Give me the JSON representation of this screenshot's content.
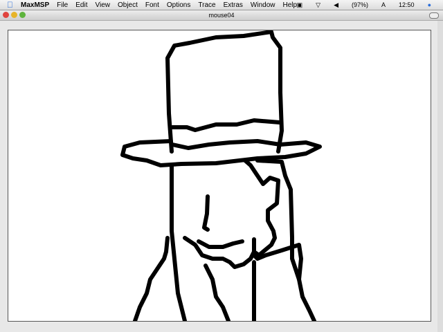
{
  "menubar": {
    "app": "MaxMSP",
    "items": [
      "File",
      "Edit",
      "View",
      "Object",
      "Font",
      "Options",
      "Trace",
      "Extras",
      "Window",
      "Help"
    ],
    "battery": "(97%)",
    "clock": "12:50"
  },
  "window": {
    "title": "mouse04"
  }
}
